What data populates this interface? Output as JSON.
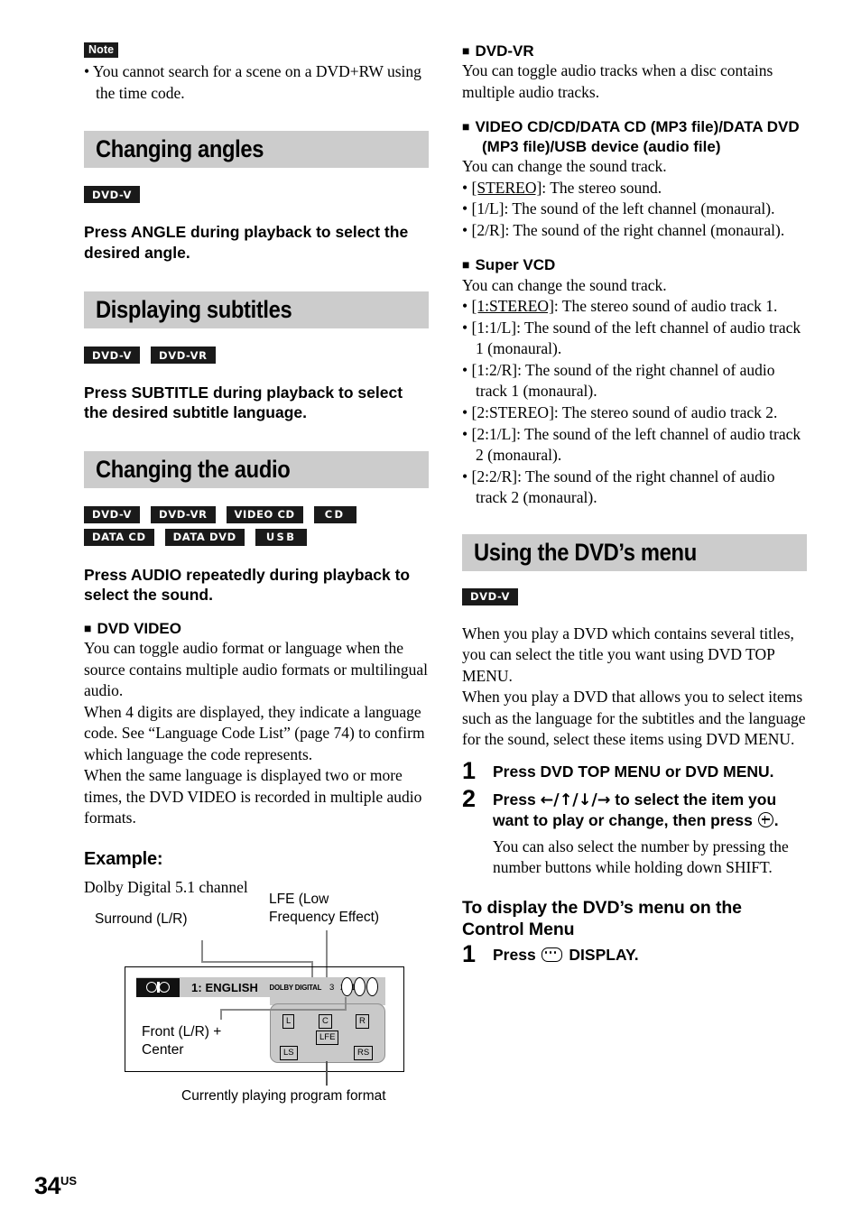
{
  "page": {
    "number": "34",
    "region_suffix": "US"
  },
  "left_column": {
    "note": {
      "tag": "Note",
      "items": [
        "You cannot search for a scene on a DVD+RW using the time code."
      ]
    },
    "section_changing_angles": {
      "title": "Changing angles",
      "badges": [
        "DVD-V"
      ],
      "instruction": "Press ANGLE during playback to select the desired angle."
    },
    "section_displaying_subtitles": {
      "title": "Displaying subtitles",
      "badges": [
        "DVD-V",
        "DVD-VR"
      ],
      "instruction": "Press SUBTITLE during playback to select the desired subtitle language."
    },
    "section_changing_the_audio": {
      "title": "Changing the audio",
      "badges": [
        "DVD-V",
        "DVD-VR",
        "VIDEO CD",
        "CD",
        "DATA CD",
        "DATA DVD",
        "USB"
      ],
      "instruction": "Press AUDIO repeatedly during playback to select the sound.",
      "dvd_video": {
        "heading": "DVD VIDEO",
        "paragraphs": [
          "You can toggle audio format or language when the source contains multiple audio formats or multilingual audio.",
          "When 4 digits are displayed, they indicate a language code. See “Language Code List” (page 74) to confirm which language the code represents.",
          "When the same language is displayed two or more times, the DVD VIDEO is recorded in multiple audio formats."
        ]
      },
      "example": {
        "heading": "Example:",
        "caption": "Dolby Digital 5.1 channel",
        "labels": {
          "surround": "Surround (L/R)",
          "lfe": "LFE (Low\nFrequency Effect)",
          "front_center": "Front (L/R) +\nCenter",
          "currently_playing": "Currently playing program format"
        },
        "osd": {
          "dolby_icon": "dolby-logo",
          "track_text": "1: ENGLISH",
          "format_text": "DOLBY DIGITAL",
          "channel_digits": [
            "3",
            "2",
            "1"
          ]
        },
        "speakers": [
          "L",
          "C",
          "R",
          "LFE",
          "LS",
          "RS"
        ]
      }
    }
  },
  "right_column": {
    "dvd_vr": {
      "heading": "DVD-VR",
      "paragraph": "You can toggle audio tracks when a disc contains multiple audio tracks."
    },
    "video_cd_group": {
      "heading": "VIDEO CD/CD/DATA CD (MP3 file)/DATA DVD (MP3 file)/USB device (audio file)",
      "paragraph": "You can change the sound track.",
      "options": [
        {
          "key": "[STEREO]",
          "underline": true,
          "desc": ": The stereo sound."
        },
        {
          "key": "[1/L]",
          "underline": false,
          "desc": ": The sound of the left channel (monaural)."
        },
        {
          "key": "[2/R]",
          "underline": false,
          "desc": ": The sound of the right channel (monaural)."
        }
      ]
    },
    "super_vcd": {
      "heading": "Super VCD",
      "paragraph": "You can change the sound track.",
      "options": [
        {
          "key": "[1:STEREO]",
          "underline": true,
          "desc": ": The stereo sound of audio track 1."
        },
        {
          "key": "[1:1/L]",
          "underline": false,
          "desc": ": The sound of the left channel of audio track 1 (monaural)."
        },
        {
          "key": "[1:2/R]",
          "underline": false,
          "desc": ": The sound of the right channel of audio track 1 (monaural)."
        },
        {
          "key": "[2:STEREO]",
          "underline": false,
          "desc": ": The stereo sound of audio track 2."
        },
        {
          "key": "[2:1/L]",
          "underline": false,
          "desc": ": The sound of the left channel of audio track 2 (monaural)."
        },
        {
          "key": "[2:2/R]",
          "underline": false,
          "desc": ": The sound of the right channel of audio track 2 (monaural)."
        }
      ]
    },
    "section_using_dvd_menu": {
      "title": "Using the DVD’s menu",
      "badges": [
        "DVD-V"
      ],
      "paragraphs": [
        "When you play a DVD which contains several titles, you can select the title you want using DVD TOP MENU.",
        "When you play a DVD that allows you to select items such as the language for the subtitles and the language for the sound, select these items using DVD MENU."
      ],
      "steps": [
        {
          "num": "1",
          "title": "Press DVD TOP MENU or DVD MENU."
        },
        {
          "num": "2",
          "title_before": "Press ",
          "arrows": "←/↑/↓/→",
          "title_mid": " to select the item you want to play or change, then press ",
          "title_after": ".",
          "note": "You can also select the number by pressing the number buttons while holding down SHIFT."
        }
      ],
      "control_menu": {
        "heading": "To display the DVD’s menu on the Control Menu",
        "step_num": "1",
        "step_before": "Press ",
        "step_after": " DISPLAY."
      }
    }
  }
}
